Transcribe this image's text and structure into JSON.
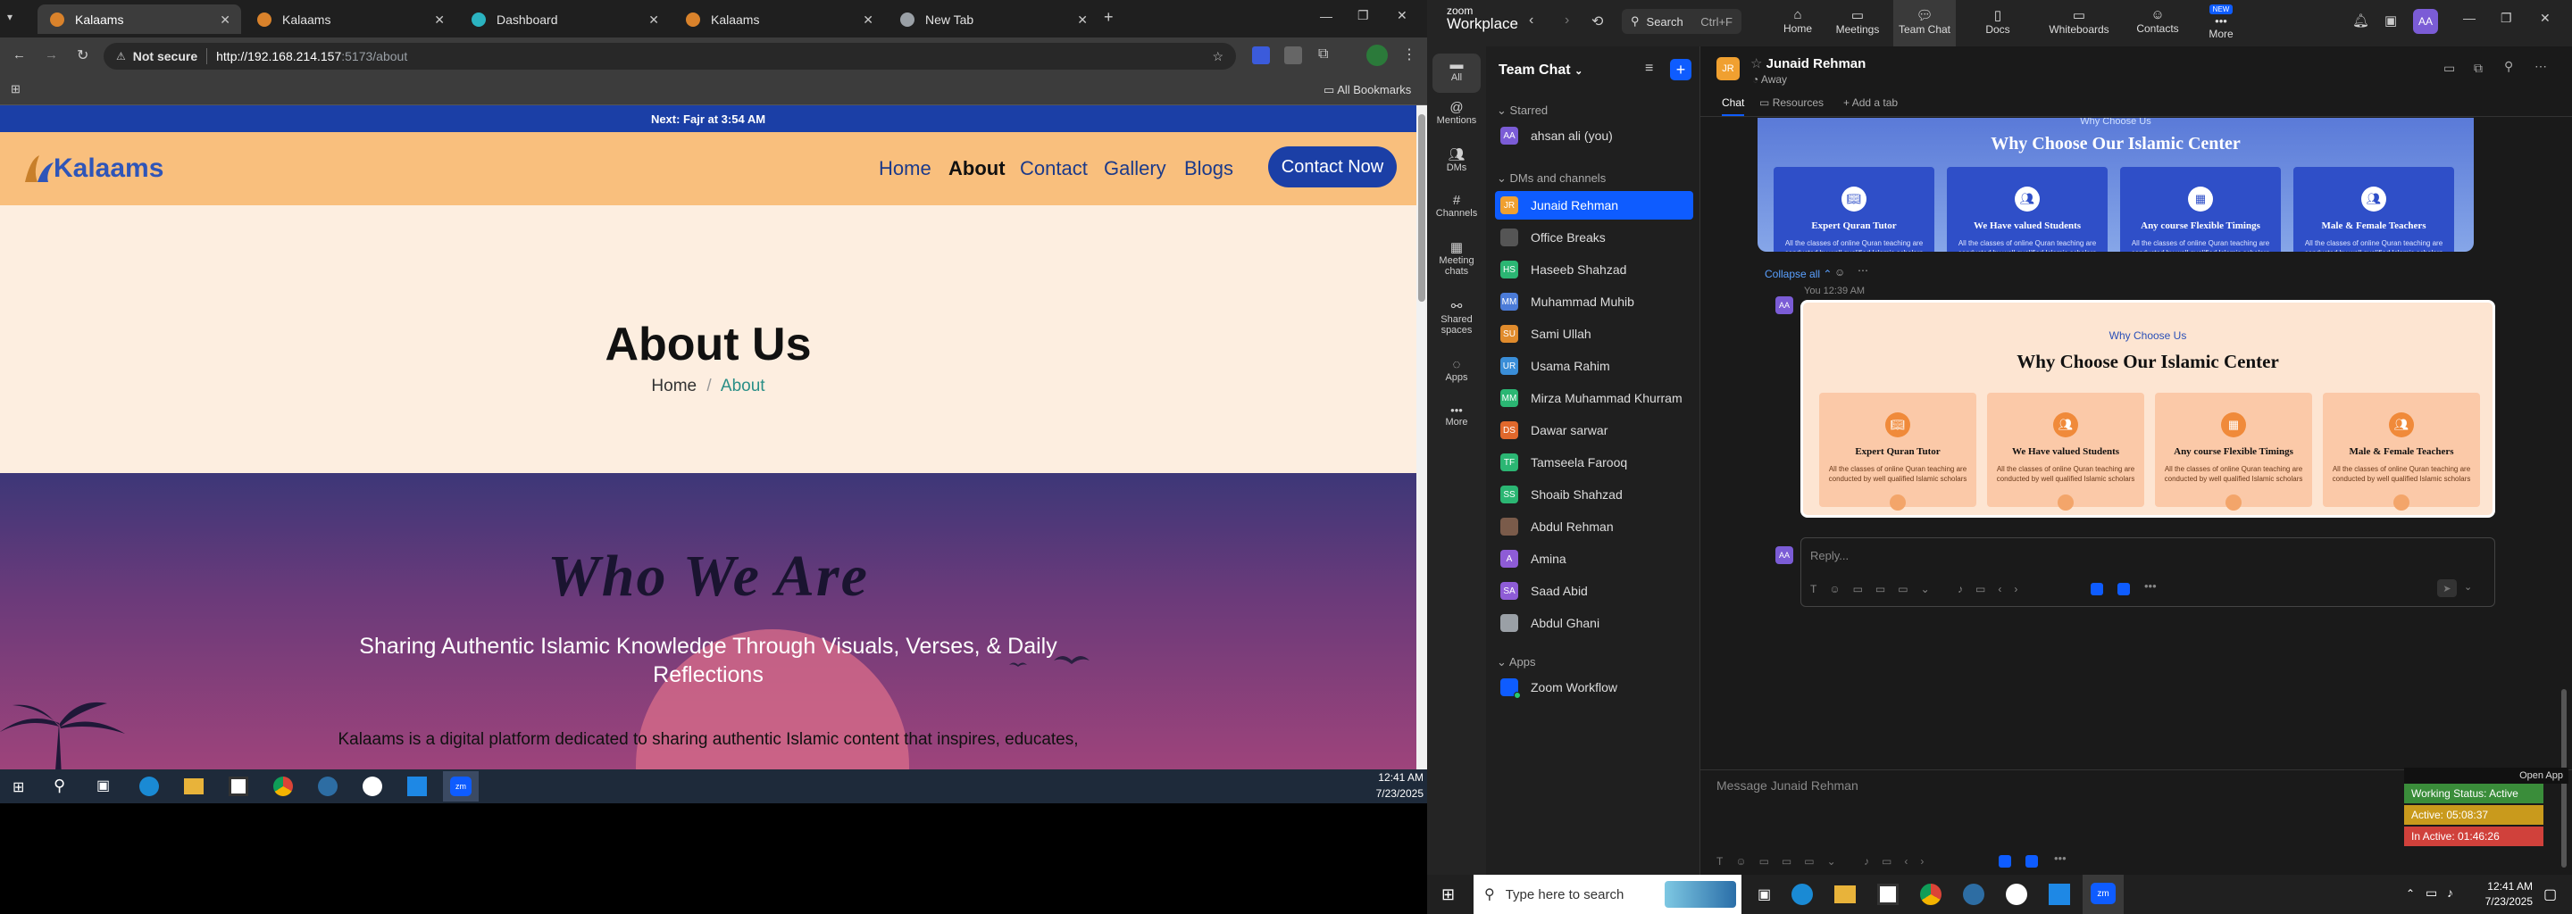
{
  "browser": {
    "tabs": [
      {
        "title": "Kalaams",
        "active": true
      },
      {
        "title": "Kalaams",
        "active": false
      },
      {
        "title": "Dashboard",
        "active": false
      },
      {
        "title": "Kalaams",
        "active": false
      },
      {
        "title": "New Tab",
        "active": false
      }
    ],
    "security_label": "Not secure",
    "url_host": "http://192.168.214.157",
    "url_rest": ":5173/about",
    "all_bookmarks": "All Bookmarks"
  },
  "site": {
    "prayer_bar": "Next: Fajr at 3:54 AM",
    "logo_text": "Kalaams",
    "nav": [
      "Home",
      "About",
      "Contact",
      "Gallery",
      "Blogs"
    ],
    "nav_active": "About",
    "cta": "Contact Now",
    "hero_title": "About Us",
    "breadcrumb_home": "Home",
    "breadcrumb_sep": "/",
    "breadcrumb_current": "About",
    "who_title": "Who We Are",
    "who_subtitle_1": "Sharing Authentic Islamic Knowledge Through Visuals, Verses, & Daily",
    "who_subtitle_2": "Reflections",
    "who_para": "Kalaams is a digital platform dedicated to sharing authentic Islamic content that inspires, educates,"
  },
  "taskbar_left": {
    "time": "12:41 AM",
    "date": "7/23/2025"
  },
  "zoom": {
    "brand_top": "zoom",
    "brand": "Workplace",
    "search": "Search",
    "search_shortcut": "Ctrl+F",
    "top_nav": [
      "Home",
      "Meetings",
      "Team Chat",
      "Docs",
      "Whiteboards",
      "Contacts",
      "More"
    ],
    "top_active": "Team Chat",
    "new_badge": "NEW",
    "profile_initials": "AA",
    "rail": [
      "All",
      "Mentions",
      "DMs",
      "Channels",
      "Meeting chats",
      "Shared spaces",
      "Apps",
      "More"
    ],
    "panel_title": "Team Chat",
    "starred_label": "Starred",
    "starred": [
      {
        "initials": "AA",
        "name": "ahsan ali (you)",
        "color": "#7b5cd6"
      }
    ],
    "dms_label": "DMs and channels",
    "contacts": [
      {
        "initials": "JR",
        "name": "Junaid Rehman",
        "color": "#f0a030",
        "selected": true
      },
      {
        "initials": "",
        "name": "Office Breaks",
        "color": "#555555",
        "selected": false
      },
      {
        "initials": "HS",
        "name": "Haseeb Shahzad",
        "color": "#2bb673",
        "selected": false
      },
      {
        "initials": "MM",
        "name": "Muhammad Muhib",
        "color": "#4b7bd8",
        "selected": false
      },
      {
        "initials": "SU",
        "name": "Sami Ullah",
        "color": "#e08b2c",
        "selected": false
      },
      {
        "initials": "UR",
        "name": "Usama Rahim",
        "color": "#3a8ed8",
        "selected": false
      },
      {
        "initials": "MM",
        "name": "Mirza Muhammad Khurram",
        "color": "#2bb673",
        "selected": false
      },
      {
        "initials": "DS",
        "name": "Dawar sarwar",
        "color": "#e0682c",
        "selected": false
      },
      {
        "initials": "TF",
        "name": "Tamseela Farooq",
        "color": "#2bb673",
        "selected": false
      },
      {
        "initials": "SS",
        "name": "Shoaib Shahzad",
        "color": "#2bb673",
        "selected": false
      },
      {
        "initials": "",
        "name": "Abdul Rehman",
        "color": "#7a5b4a",
        "selected": false
      },
      {
        "initials": "A",
        "name": "Amina",
        "color": "#8e5cd6",
        "selected": false
      },
      {
        "initials": "SA",
        "name": "Saad Abid",
        "color": "#8e5cd6",
        "selected": false
      },
      {
        "initials": "",
        "name": "Abdul Ghani",
        "color": "#9aa0a6",
        "selected": false
      }
    ],
    "apps_label": "Apps",
    "apps": [
      {
        "name": "Zoom Workflow",
        "color": "#0e5cff"
      }
    ],
    "chat_header_initials": "JR",
    "chat_header_name": "Junaid Rehman",
    "chat_header_status": "Away",
    "chat_tabs": [
      "Chat",
      "Resources",
      "Add a tab"
    ],
    "collapse_all": "Collapse all",
    "message_meta": "You 12:39 AM",
    "message_sender_initials": "AA",
    "reply_placeholder": "Reply...",
    "composer_placeholder": "Message Junaid Rehman",
    "open_app": "Open App",
    "working_status": "Working Status: Active",
    "active_time": "Active: 05:08:37",
    "inactive_time": "In Active: 01:46:26"
  },
  "why_card": {
    "eyebrow": "Why Choose Us",
    "title": "Why Choose Our Islamic Center",
    "features": [
      {
        "title": "Expert Quran Tutor",
        "desc": "All the classes of online Quran teaching are conducted by well qualified Islamic scholars",
        "icon": "book-icon"
      },
      {
        "title": "We Have valued Students",
        "desc": "All the classes of online Quran teaching are conducted by well qualified Islamic scholars",
        "icon": "people-icon"
      },
      {
        "title": "Any course Flexible Timings",
        "desc": "All the classes of online Quran teaching are conducted by well qualified Islamic scholars",
        "icon": "calendar-icon"
      },
      {
        "title": "Male & Female Teachers",
        "desc": "All the classes of online Quran teaching are conducted by well qualified Islamic scholars",
        "icon": "teachers-icon"
      }
    ]
  },
  "taskbar_right": {
    "search_placeholder": "Type here to search",
    "time": "12:41 AM",
    "date": "7/23/2025"
  },
  "colors": {
    "nav_bg": "#f9bf7d",
    "cta": "#1b3fa6",
    "zoom_blue": "#0e5cff",
    "teal": "#2a8f87"
  }
}
